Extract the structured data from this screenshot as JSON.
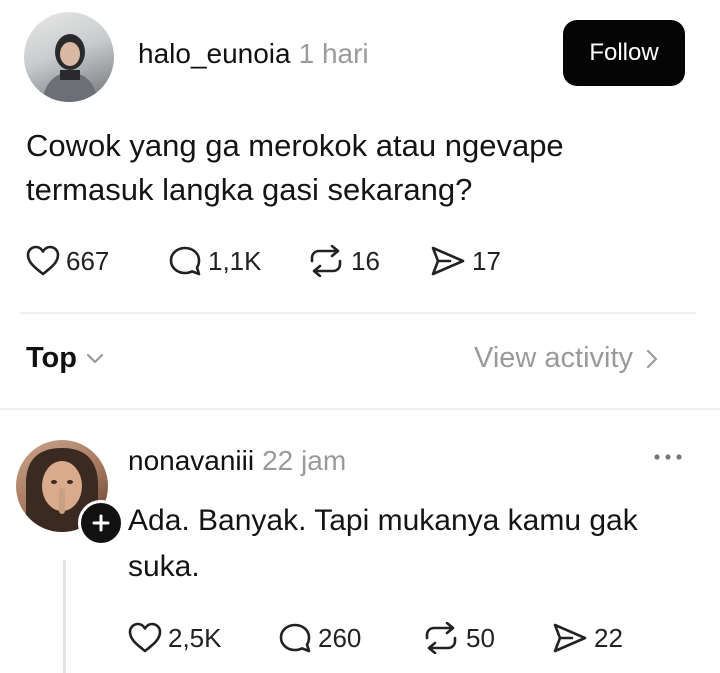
{
  "post": {
    "username": "halo_eunoia",
    "time": "1 hari",
    "follow_label": "Follow",
    "text_line1": "Cowok yang ga merokok atau ngevape",
    "text_line2": "termasuk langka gasi sekarang?",
    "likes": "667",
    "comments": "1,1K",
    "reposts": "16",
    "shares": "17"
  },
  "sort": {
    "label": "Top",
    "view_activity_label": "View activity"
  },
  "reply": {
    "username": "nonavaniii",
    "time": "22 jam",
    "text_line1": "Ada. Banyak. Tapi mukanya kamu gak",
    "text_line2": "suka.",
    "likes": "2,5K",
    "comments": "260",
    "reposts": "50",
    "shares": "22"
  },
  "icons": {
    "like": "heart-icon",
    "comment": "comment-bubble-icon",
    "repost": "repost-icon",
    "share": "send-icon",
    "more": "more-dots-icon",
    "chevron_down": "chevron-down-icon",
    "chevron_right": "chevron-right-icon",
    "plus": "plus-icon"
  }
}
